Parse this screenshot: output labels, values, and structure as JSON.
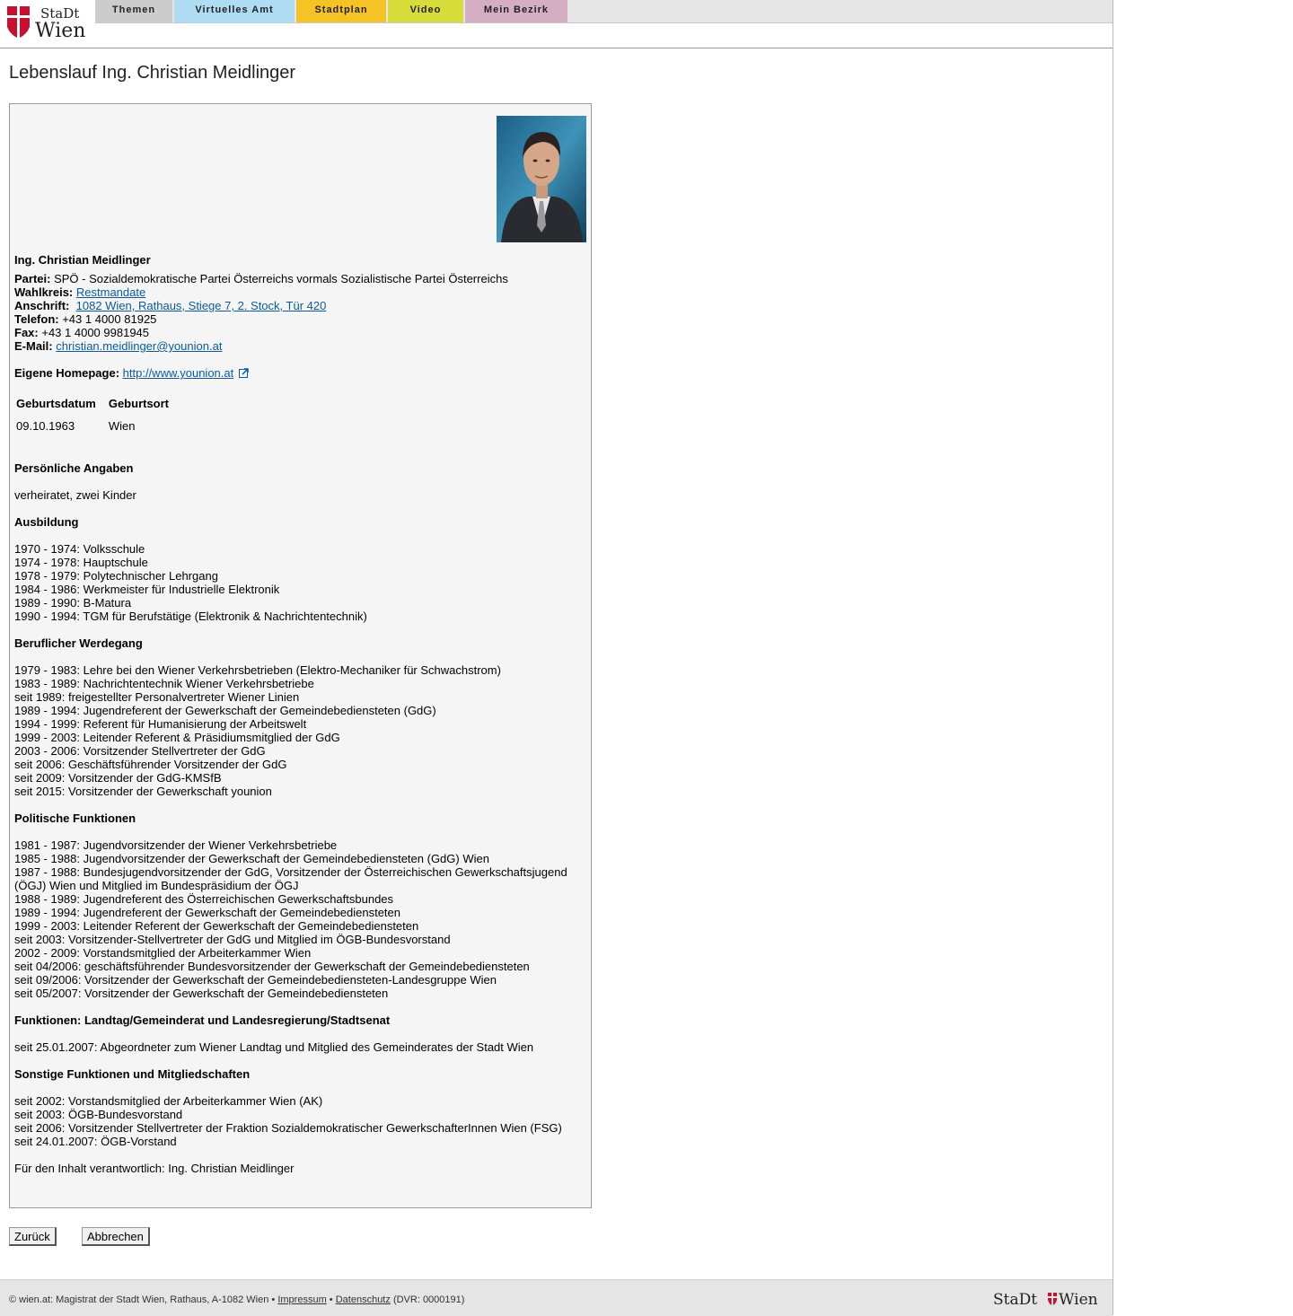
{
  "logo": {
    "line1": "StaDt",
    "line2": "Wien"
  },
  "nav": {
    "themen": "Themen",
    "virtuelles_amt": "Virtuelles Amt",
    "stadtplan": "Stadtplan",
    "video": "Video",
    "mein_bezirk": "Mein Bezirk"
  },
  "page_title": "Lebenslauf Ing. Christian Meidlinger",
  "profile": {
    "name": "Ing. Christian Meidlinger",
    "partei_label": "Partei:",
    "partei": "SPÖ - Sozialdemokratische Partei Österreichs vormals Sozialistische Partei Österreichs",
    "wahlkreis_label": "Wahlkreis:",
    "wahlkreis": "Restmandate",
    "anschrift_label": "Anschrift:",
    "anschrift": "1082 Wien, Rathaus, Stiege 7, 2. Stock, Tür 420",
    "telefon_label": "Telefon:",
    "telefon": "+43 1 4000 81925",
    "fax_label": "Fax:",
    "fax": "+43 1 4000 9981945",
    "email_label": "E-Mail:",
    "email": "christian.meidlinger@younion.at",
    "homepage_label": "Eigene Homepage:",
    "homepage": "http://www.younion.at"
  },
  "birth_table": {
    "headers": [
      "Geburtsdatum",
      "Geburtsort"
    ],
    "row": [
      "09.10.1963",
      "Wien"
    ]
  },
  "sections": [
    {
      "title": "Persönliche Angaben",
      "lines": [
        "verheiratet, zwei Kinder"
      ]
    },
    {
      "title": "Ausbildung",
      "lines": [
        "1970 - 1974: Volksschule",
        "1974 - 1978: Hauptschule",
        "1978 - 1979: Polytechnischer Lehrgang",
        "1984 - 1986: Werkmeister für Industrielle Elektronik",
        "1989 - 1990: B-Matura",
        "1990 - 1994: TGM für Berufstätige (Elektronik & Nachrichtentechnik)"
      ]
    },
    {
      "title": "Beruflicher Werdegang",
      "lines": [
        "1979 - 1983: Lehre bei den Wiener Verkehrsbetrieben (Elektro-Mechaniker für Schwachstrom)",
        "1983 - 1989: Nachrichtentechnik Wiener Verkehrsbetriebe",
        "seit 1989: freigestellter Personalvertreter Wiener Linien",
        "1989 - 1994: Jugendreferent der Gewerkschaft der Gemeindebediensteten (GdG)",
        "1994 - 1999: Referent für Humanisierung der Arbeitswelt",
        "1999 - 2003: Leitender Referent & Präsidiumsmitglied der GdG",
        "2003 - 2006: Vorsitzender Stellvertreter der GdG",
        "seit 2006: Geschäftsführender Vorsitzender der GdG",
        "seit 2009: Vorsitzender der GdG-KMSfB",
        "seit 2015: Vorsitzender der Gewerkschaft younion"
      ]
    },
    {
      "title": "Politische Funktionen",
      "lines": [
        "1981 - 1987: Jugendvorsitzender der Wiener Verkehrsbetriebe",
        "1985 - 1988: Jugendvorsitzender der Gewerkschaft der Gemeindebediensteten (GdG) Wien",
        "1987 - 1988: Bundesjugendvorsitzender der GdG, Vorsitzender der Österreichischen Gewerkschaftsjugend (ÖGJ) Wien und Mitglied im Bundespräsidium der ÖGJ",
        "1988 - 1989: Jugendreferent des Österreichischen Gewerkschaftsbundes",
        "1989 - 1994: Jugendreferent der Gewerkschaft der Gemeindebediensteten",
        "1999 - 2003: Leitender Referent der Gewerkschaft der Gemeindebediensteten",
        "seit 2003: Vorsitzender-Stellvertreter der GdG und Mitglied im ÖGB-Bundesvorstand",
        "2002 - 2009: Vorstandsmitglied der Arbeiterkammer Wien",
        "seit 04/2006: geschäftsführender Bundesvorsitzender der Gewerkschaft der Gemeindebediensteten",
        "seit 09/2006: Vorsitzender der Gewerkschaft der Gemeindebediensteten-Landesgruppe Wien",
        "seit 05/2007: Vorsitzender der Gewerkschaft der Gemeindebediensteten"
      ]
    },
    {
      "title": "Funktionen: Landtag/Gemeinderat und Landesregierung/Stadtsenat",
      "lines": [
        "seit 25.01.2007: Abgeordneter zum Wiener Landtag und Mitglied des Gemeinderates der Stadt Wien"
      ]
    },
    {
      "title": "Sonstige Funktionen und Mitgliedschaften",
      "lines": [
        "seit 2002: Vorstandsmitglied der Arbeiterkammer Wien (AK)",
        "seit 2003: ÖGB-Bundesvorstand",
        "seit 2006: Vorsitzender Stellvertreter der Fraktion Sozialdemokratischer GewerkschafterInnen Wien (FSG)",
        "seit 24.01.2007: ÖGB-Vorstand"
      ]
    }
  ],
  "responsible": "Für den Inhalt verantwortlich: Ing. Christian Meidlinger",
  "buttons": {
    "back": "Zurück",
    "cancel": "Abbrechen"
  },
  "footer": {
    "text_before": "© wien.at: Magistrat der Stadt Wien, Rathaus, A-1082 Wien •",
    "impressum": "Impressum",
    "sep": "•",
    "datenschutz": "Datenschutz",
    "dvr": "(DVR: 0000191)",
    "logo_left": "StaDt",
    "logo_right": "Wien"
  },
  "colors": {
    "link": "#0a5a9c",
    "wien_red": "#c8102e",
    "tab_themen": "#cccccc",
    "tab_amt": "#aedcf3",
    "tab_stadtplan": "#f6c327",
    "tab_video": "#d7dc3b",
    "tab_bezirk": "#d5aec4"
  }
}
